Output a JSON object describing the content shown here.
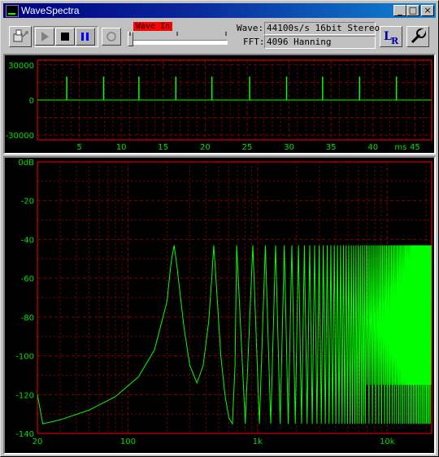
{
  "window": {
    "title": "WaveSpectra"
  },
  "title_buttons": {
    "minimize": "_",
    "maximize": "□",
    "close": "×"
  },
  "toolbar": {
    "wave_in_label": "Wave In",
    "wave_label": "Wave:",
    "wave_format": "44100s/s 16bit Stereo",
    "fft_label": "FFT:",
    "fft_settings": "4096  Hanning",
    "lr_button": "LR"
  },
  "colors": {
    "trace": "#00ff00",
    "grid": "#800000",
    "axis_text": "#00e000",
    "frame": "#ff0000",
    "wave_in": "#ff0000"
  },
  "chart_data": [
    {
      "type": "line",
      "name": "waveform",
      "xlabel": "ms",
      "x_ticks": [
        5,
        10,
        15,
        20,
        25,
        30,
        35,
        40,
        45
      ],
      "y_ticks": [
        30000,
        0,
        -30000
      ],
      "xlim": [
        0,
        47
      ],
      "ylim": [
        -34000,
        34000
      ],
      "impulse_times_ms": [
        3.5,
        7.9,
        12.1,
        16.5,
        20.8,
        25.3,
        29.7,
        34.0,
        38.4,
        42.8
      ],
      "impulse_amplitude": 20000
    },
    {
      "type": "line",
      "name": "spectrum",
      "x_scale": "log",
      "xlim": [
        20,
        22050
      ],
      "ylim": [
        -140,
        0
      ],
      "x_ticks": [
        "20",
        "100",
        "1k",
        "10k"
      ],
      "y_ticks": [
        "0dB",
        "-20",
        "-40",
        "-60",
        "-80",
        "-100",
        "-120",
        "-140"
      ],
      "peaks_hz": [
        227,
        459,
        689,
        918,
        1148,
        1378,
        1607,
        1837,
        2067,
        2296
      ],
      "harmonic_spacing_hz": 229.7,
      "peak_level_db": -43,
      "points": [
        [
          20,
          -120
        ],
        [
          22,
          -135
        ],
        [
          30,
          -133
        ],
        [
          50,
          -128
        ],
        [
          80,
          -121
        ],
        [
          120,
          -111
        ],
        [
          160,
          -97
        ],
        [
          200,
          -72
        ],
        [
          215,
          -52
        ],
        [
          227,
          -43
        ],
        [
          240,
          -55
        ],
        [
          270,
          -85
        ],
        [
          300,
          -105
        ],
        [
          340,
          -114
        ],
        [
          380,
          -105
        ],
        [
          420,
          -82
        ],
        [
          445,
          -58
        ],
        [
          459,
          -43
        ],
        [
          475,
          -58
        ],
        [
          520,
          -100
        ],
        [
          560,
          -120
        ],
        [
          600,
          -132
        ],
        [
          640,
          -135
        ],
        [
          670,
          -105
        ],
        [
          689,
          -43
        ]
      ]
    }
  ]
}
